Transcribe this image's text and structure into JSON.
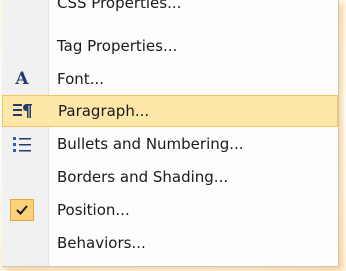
{
  "menu": {
    "items": [
      {
        "label": "CSS Properties...",
        "icon": "none"
      },
      {
        "label": "Tag Properties...",
        "icon": "none"
      },
      {
        "label": "Font...",
        "icon": "font-icon",
        "glyph": "A"
      },
      {
        "label": "Paragraph...",
        "icon": "paragraph-icon"
      },
      {
        "label": "Bullets and Numbering...",
        "icon": "bullets-icon"
      },
      {
        "label": "Borders and Shading...",
        "icon": "none"
      },
      {
        "label": "Position...",
        "icon": "checkmark-icon",
        "checked": true
      },
      {
        "label": "Behaviors...",
        "icon": "none"
      }
    ],
    "highlighted": "Paragraph...",
    "colors": {
      "highlight_fill": "#fde7a9",
      "highlight_border": "#f2c75d",
      "check_box": "#fbd27a",
      "icon_blue": "#243a6b",
      "glow": "#f0aa3c"
    }
  }
}
